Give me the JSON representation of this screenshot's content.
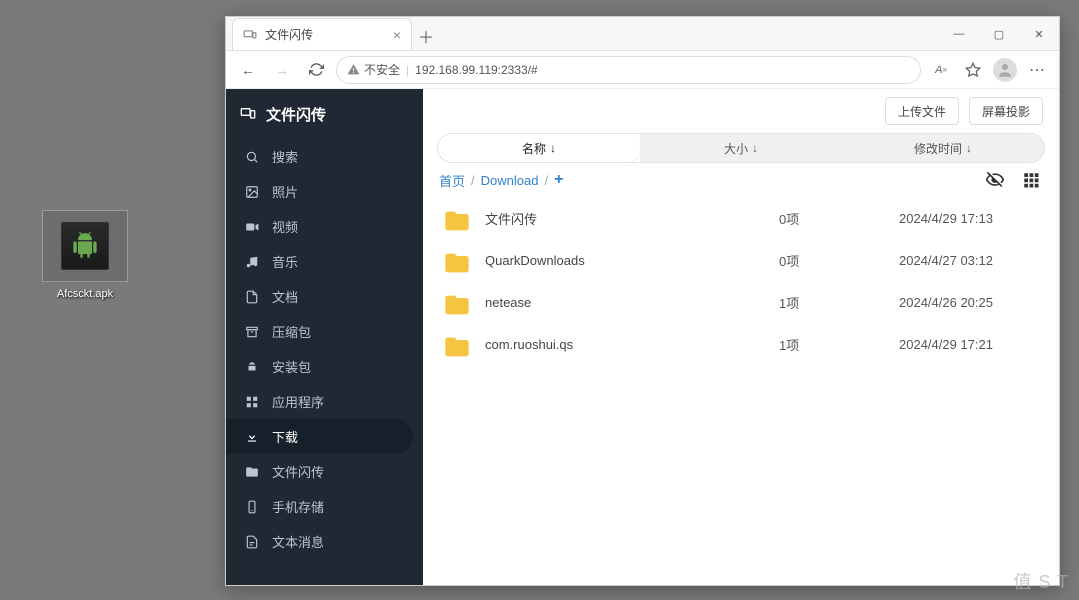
{
  "desktop": {
    "icon_label": "Afcsckt.apk"
  },
  "browser": {
    "tab_title": "文件闪传",
    "security_label": "不安全",
    "url": "192.168.99.119:2333/#"
  },
  "app": {
    "brand": "文件闪传",
    "sidebar": [
      {
        "id": "search",
        "label": "搜索"
      },
      {
        "id": "photos",
        "label": "照片"
      },
      {
        "id": "videos",
        "label": "视频"
      },
      {
        "id": "music",
        "label": "音乐"
      },
      {
        "id": "docs",
        "label": "文档"
      },
      {
        "id": "archives",
        "label": "压缩包"
      },
      {
        "id": "apks",
        "label": "安装包"
      },
      {
        "id": "apps",
        "label": "应用程序"
      },
      {
        "id": "download",
        "label": "下载",
        "active": true
      },
      {
        "id": "flash",
        "label": "文件闪传"
      },
      {
        "id": "storage",
        "label": "手机存储"
      },
      {
        "id": "msg",
        "label": "文本消息"
      }
    ],
    "actions": {
      "upload": "上传文件",
      "cast": "屏幕投影"
    },
    "sort": {
      "name": "名称",
      "size": "大小",
      "mtime": "修改时间",
      "arrow": "↓"
    },
    "breadcrumb": {
      "home": "首页",
      "path_0": "Download"
    },
    "files": [
      {
        "name": "文件闪传",
        "size": "0项",
        "mtime": "2024/4/29 17:13"
      },
      {
        "name": "QuarkDownloads",
        "size": "0项",
        "mtime": "2024/4/27 03:12"
      },
      {
        "name": "netease",
        "size": "1项",
        "mtime": "2024/4/26 20:25"
      },
      {
        "name": "com.ruoshui.qs",
        "size": "1项",
        "mtime": "2024/4/29 17:21"
      }
    ]
  },
  "watermark": "值     S           T"
}
